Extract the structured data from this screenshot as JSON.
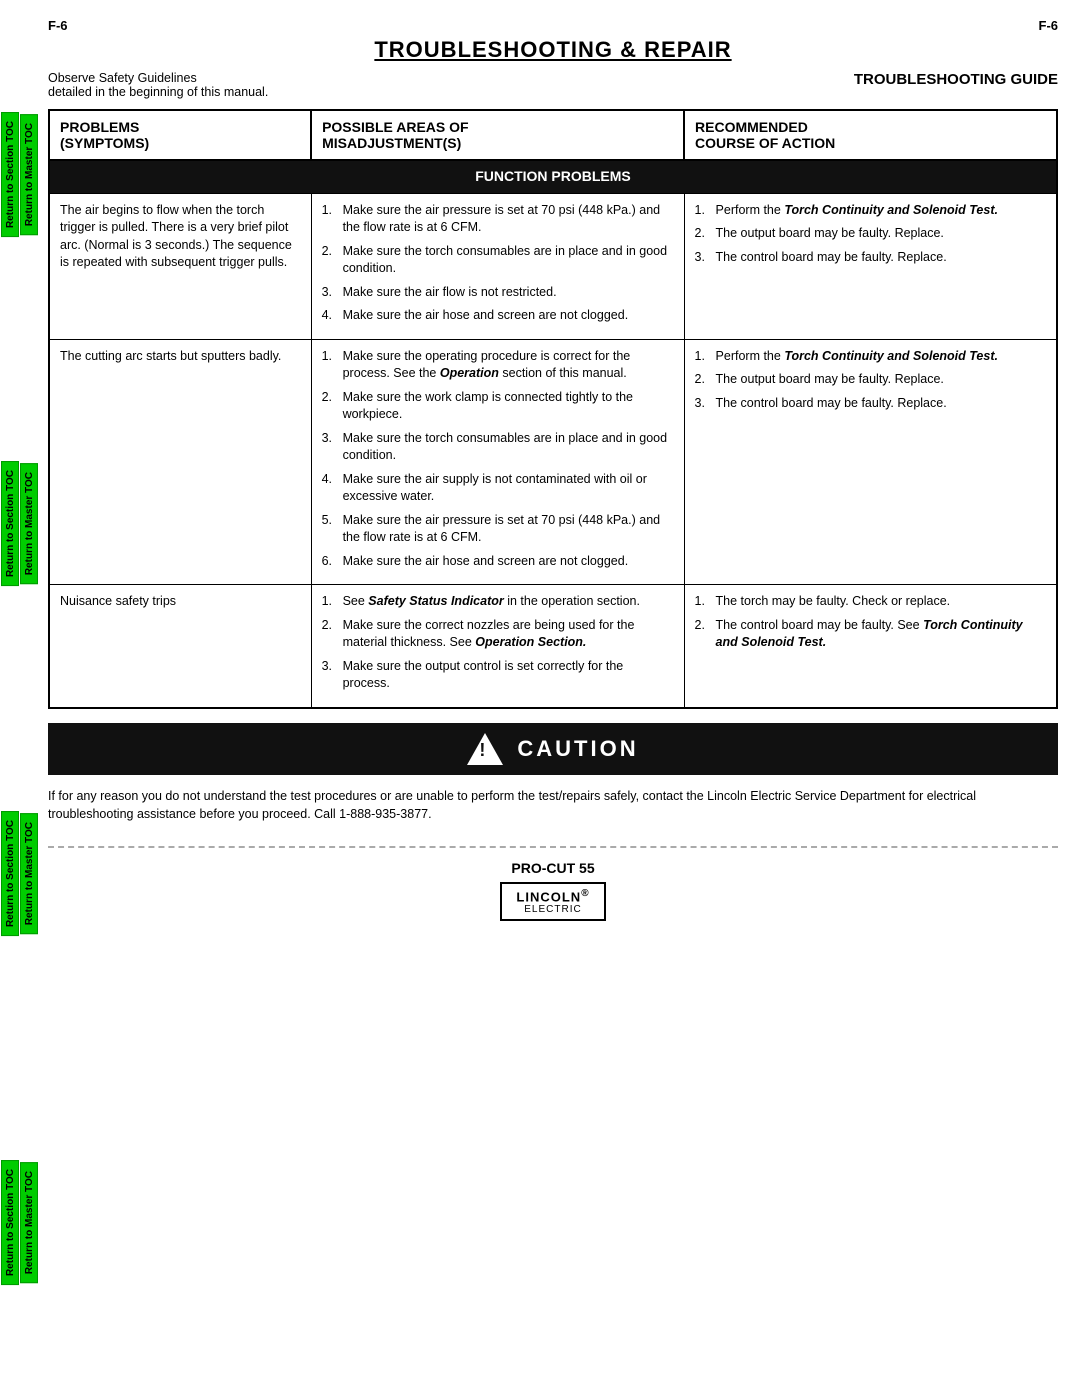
{
  "page": {
    "number_left": "F-6",
    "number_right": "F-6",
    "title": "TROUBLESHOOTING & REPAIR",
    "safety_note_line1": "Observe Safety Guidelines",
    "safety_note_line2": "detailed in the beginning of this manual.",
    "section_title": "TROUBLESHOOTING GUIDE"
  },
  "sidebar": {
    "tabs": [
      {
        "label": "Return to Section TOC",
        "id": "tab-section-toc-1"
      },
      {
        "label": "Return to Master TOC",
        "id": "tab-master-toc-1"
      },
      {
        "label": "Return to Section TOC",
        "id": "tab-section-toc-2"
      },
      {
        "label": "Return to Master TOC",
        "id": "tab-master-toc-2"
      },
      {
        "label": "Return to Section TOC",
        "id": "tab-section-toc-3"
      },
      {
        "label": "Return to Master TOC",
        "id": "tab-master-toc-3"
      },
      {
        "label": "Return to Section TOC",
        "id": "tab-section-toc-4"
      },
      {
        "label": "Return to Master TOC",
        "id": "tab-master-toc-4"
      }
    ]
  },
  "table": {
    "col_headers": [
      "PROBLEMS\n(SYMPTOMS)",
      "POSSIBLE AREAS OF\nMISADJUSTMENT(S)",
      "RECOMMENDED\nCOURSE OF ACTION"
    ],
    "function_problems_label": "FUNCTION PROBLEMS",
    "rows": [
      {
        "problem": "The air begins to flow when the torch trigger is pulled. There is a very brief pilot arc. (Normal is 3 seconds.) The sequence is repeated with subsequent trigger pulls.",
        "possible": [
          "Make sure the air pressure is set at 70 psi (448 kPa.) and the flow rate is at 6 CFM.",
          "Make sure the torch consumables are in place and in good condition.",
          "Make sure the air flow is not restricted.",
          "Make sure the air hose and screen are not clogged."
        ],
        "recommended": [
          {
            "text": "Perform the ",
            "bold_italic": "Torch Continuity and Solenoid Test.",
            "suffix": ""
          },
          {
            "text": "The output board may be faulty. Replace.",
            "bold_italic": "",
            "suffix": ""
          },
          {
            "text": "The control board may be faulty. Replace.",
            "bold_italic": "",
            "suffix": ""
          }
        ]
      },
      {
        "problem": "The cutting arc starts but sputters badly.",
        "possible": [
          "Make sure the operating procedure is correct for the process. See the Operation section of this manual.",
          "Make sure the work clamp is connected tightly to the workpiece.",
          "Make sure the torch consumables are in place and in good condition.",
          "Make sure the air supply is not contaminated with oil or excessive water.",
          "Make sure the air pressure is set at 70 psi (448 kPa.) and the flow rate is at 6 CFM.",
          "Make sure the air hose and screen are not clogged."
        ],
        "recommended": [
          {
            "text": "Perform the ",
            "bold_italic": "Torch Continuity and Solenoid Test.",
            "suffix": ""
          },
          {
            "text": "The output board may be faulty. Replace.",
            "bold_italic": "",
            "suffix": ""
          },
          {
            "text": "The control board may be faulty. Replace.",
            "bold_italic": "",
            "suffix": ""
          }
        ]
      },
      {
        "problem": "Nuisance safety trips",
        "possible_mixed": [
          {
            "text": "See ",
            "bold_italic": "Safety Status Indicator",
            "suffix": " in the operation section."
          },
          {
            "text": "Make sure the correct nozzles are being used for the material thickness. See ",
            "bold_italic": "Operation Section.",
            "suffix": ""
          },
          {
            "text": "Make sure the output control is set correctly for the process.",
            "bold_italic": "",
            "suffix": ""
          }
        ],
        "recommended": [
          {
            "text": "The torch may be faulty. Check or replace.",
            "bold_italic": "",
            "suffix": ""
          },
          {
            "text": "The control board may be faulty. See ",
            "bold_italic": "Torch Continuity and Solenoid Test.",
            "suffix": ""
          }
        ]
      }
    ]
  },
  "caution": {
    "title": "CAUTION",
    "description": "If for any reason you do not understand the test procedures or are unable to perform the test/repairs safely, contact the Lincoln Electric Service Department for electrical troubleshooting assistance before you proceed. Call 1-888-935-3877."
  },
  "footer": {
    "product": "PRO-CUT 55",
    "brand": "LINCOLN",
    "brand_circle": "®",
    "brand_sub": "ELECTRIC"
  }
}
